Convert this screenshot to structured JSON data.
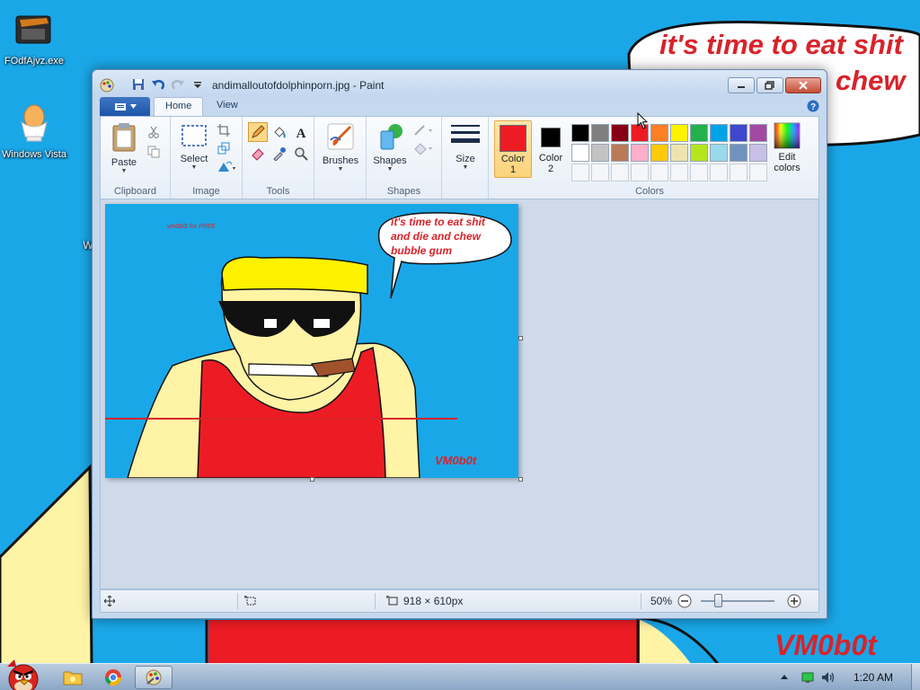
{
  "wallpaper": {
    "speech_line1": "it's time to eat shit",
    "speech_line2": "chew",
    "signature": "VM0b0t"
  },
  "desktop": {
    "icons": [
      {
        "label": "FOdfAjvz.exe",
        "icon": "executable-icon"
      },
      {
        "label": "Windows Vista",
        "icon": "egg-cup-icon"
      }
    ],
    "hidden_text": "W"
  },
  "window": {
    "title": "andimalloutofdolphinporn.jpg - Paint",
    "tabs": [
      "Home",
      "View"
    ]
  },
  "ribbon": {
    "groups": [
      "Clipboard",
      "Image",
      "Tools",
      "Shapes",
      "Colors"
    ],
    "buttons": {
      "paste": "Paste",
      "select": "Select",
      "brushes": "Brushes",
      "shapes": "Shapes",
      "size": "Size",
      "color1_line1": "Color",
      "color1_line2": "1",
      "color2_line1": "Color",
      "color2_line2": "2",
      "edit_colors_line1": "Edit",
      "edit_colors_line2": "colors"
    },
    "color1": "#ed1c24",
    "color2": "#000000",
    "palette": [
      "#000000",
      "#7f7f7f",
      "#880015",
      "#ed1c24",
      "#ff7f27",
      "#fff200",
      "#22b14c",
      "#00a2e8",
      "#3f48cc",
      "#a349a4",
      "#ffffff",
      "#c3c3c3",
      "#b97a57",
      "#ffaec9",
      "#ffc90e",
      "#efe4b0",
      "#b5e61d",
      "#99d9ea",
      "#7092be",
      "#c8bfe7"
    ]
  },
  "canvas": {
    "credit": "vm0b0t for FREE",
    "speech": "it's time to eat shit and die and chew bubble gum",
    "signature": "VM0b0t"
  },
  "status": {
    "dimensions": "918 × 610px",
    "zoom": "50%"
  },
  "taskbar": {
    "clock": "1:20 AM"
  },
  "colors": {
    "sky": "#1aa7e8",
    "skin": "#fff3a6",
    "shirt": "#ed1c24",
    "hat": "#fff200",
    "accent_text": "#d8232a"
  }
}
